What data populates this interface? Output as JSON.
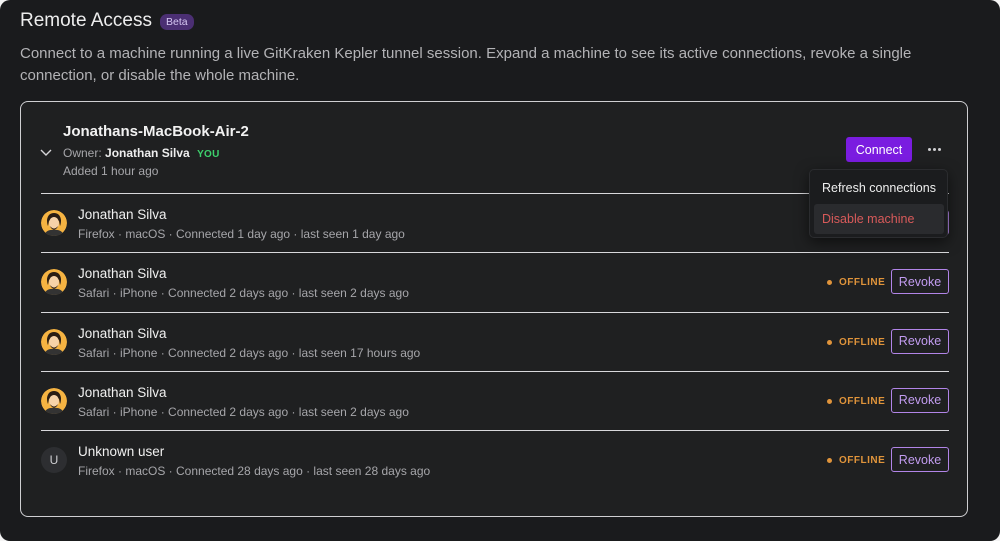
{
  "header": {
    "title": "Remote Access",
    "badge": "Beta"
  },
  "description": "Connect to a machine running a live GitKraken Kepler tunnel session. Expand a machine to see its active connections, revoke a single connection, or disable the whole machine.",
  "machine": {
    "name": "Jonathans-MacBook-Air-2",
    "owner_label": "Owner:",
    "owner_name": "Jonathan Silva",
    "owner_tag": "YOU",
    "added": "Added 1 hour ago",
    "connect_label": "Connect"
  },
  "menu": {
    "refresh_label": "Refresh connections",
    "disable_label": "Disable machine"
  },
  "connections": [
    {
      "name": "Jonathan Silva",
      "meta": "Firefox · macOS · Connected 1 day ago · last seen 1 day ago",
      "status": "",
      "revoke": "Revoke",
      "avatar": "photo"
    },
    {
      "name": "Jonathan Silva",
      "meta": "Safari · iPhone · Connected 2 days ago · last seen 2 days ago",
      "status": "OFFLINE",
      "revoke": "Revoke",
      "avatar": "photo"
    },
    {
      "name": "Jonathan Silva",
      "meta": "Safari · iPhone · Connected 2 days ago · last seen 17 hours ago",
      "status": "OFFLINE",
      "revoke": "Revoke",
      "avatar": "photo"
    },
    {
      "name": "Jonathan Silva",
      "meta": "Safari · iPhone · Connected 2 days ago · last seen 2 days ago",
      "status": "OFFLINE",
      "revoke": "Revoke",
      "avatar": "photo"
    },
    {
      "name": "Unknown user",
      "meta": "Firefox · macOS · Connected 28 days ago · last seen 28 days ago",
      "status": "OFFLINE",
      "revoke": "Revoke",
      "avatar": "U"
    }
  ],
  "colors": {
    "accent": "#7a1ce0",
    "offline": "#e0943b",
    "danger": "#d85a5a",
    "you": "#3dd16d"
  }
}
